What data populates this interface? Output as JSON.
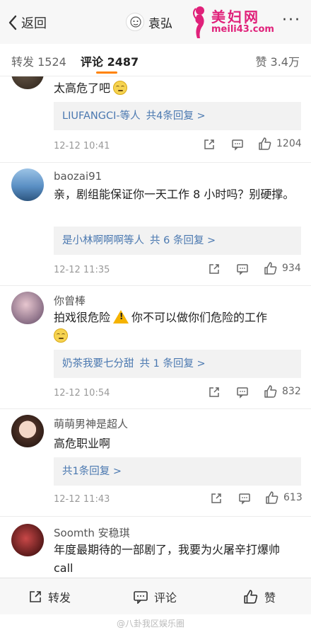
{
  "nav": {
    "back_label": "返回",
    "title": "袁弘",
    "more": "···"
  },
  "watermark": {
    "brand": "美妇网",
    "url": "meili43.com"
  },
  "tabs": {
    "repost": "转发 1524",
    "comment": "评论 2487",
    "like": "赞 3.4万"
  },
  "comments": [
    {
      "name": "",
      "text": "太高危了吧",
      "replies_user": "LIUFANGCI-等人",
      "replies_link": "共4条回复 >",
      "time": "12-12 10:41",
      "likes": "1204"
    },
    {
      "name": "baozai91",
      "text": "亲，剧组能保证你一天工作 8 小时吗？别硬撑。",
      "replies_user": "是小林啊啊啊等人",
      "replies_link": "共 6 条回复 >",
      "time": "12-12 11:35",
      "likes": "934"
    },
    {
      "name": "你曾棒",
      "text_a": "拍戏很危险",
      "text_b": "你不可以做你们危险的工作",
      "replies_user": "奶茶我要七分甜",
      "replies_link": "共 1 条回复 >",
      "time": "12-12 10:54",
      "likes": "832"
    },
    {
      "name": "萌萌男神是超人",
      "text": "高危职业啊",
      "replies_user": "",
      "replies_link": "共1条回复 >",
      "time": "12-12 11:43",
      "likes": "613"
    },
    {
      "name": "Soomth 安稳琪",
      "text": "年度最期待的一部剧了，我要为火屠辛打爆帅 call"
    }
  ],
  "bottom": {
    "repost": "转发",
    "comment": "评论",
    "like": "赞"
  },
  "footer_watermark": "@八卦我区娱乐圈",
  "colors": {
    "accent": "#ff8200",
    "link": "#4a78b0",
    "watermark": "#e0217a"
  }
}
